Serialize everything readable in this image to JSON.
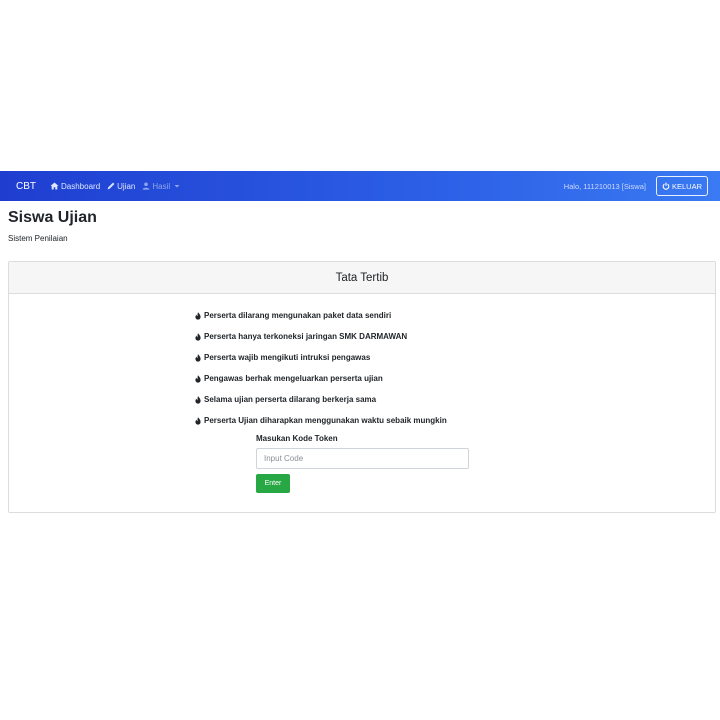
{
  "navbar": {
    "brand": "CBT",
    "items": [
      {
        "label": "Dashboard",
        "icon": "home-icon"
      },
      {
        "label": "Ujian",
        "icon": "pencil-icon"
      },
      {
        "label": "Hasil",
        "icon": "user-icon",
        "dropdown": true
      }
    ],
    "greeting": "Halo, 111210013 [Siswa]",
    "logout_label": "KELUAR"
  },
  "page": {
    "title": "Siswa Ujian",
    "subtitle": "Sistem Penilaian"
  },
  "card": {
    "header": "Tata Tertib",
    "rules": [
      "Perserta dilarang mengunakan paket data sendiri",
      "Perserta hanya terkoneksi jaringan SMK DARMAWAN",
      "Perserta wajib mengikuti intruksi pengawas",
      "Pengawas berhak mengeluarkan perserta ujian",
      "Selama ujian perserta dilarang berkerja sama",
      "Perserta Ujian diharapkan menggunakan waktu sebaik mungkin"
    ],
    "token_label": "Masukan Kode Token",
    "token_placeholder": "Input Code",
    "enter_label": "Enter"
  },
  "colors": {
    "navbar_start": "#1f3ed0",
    "navbar_end": "#3a7af2",
    "button_success": "#28a745"
  }
}
